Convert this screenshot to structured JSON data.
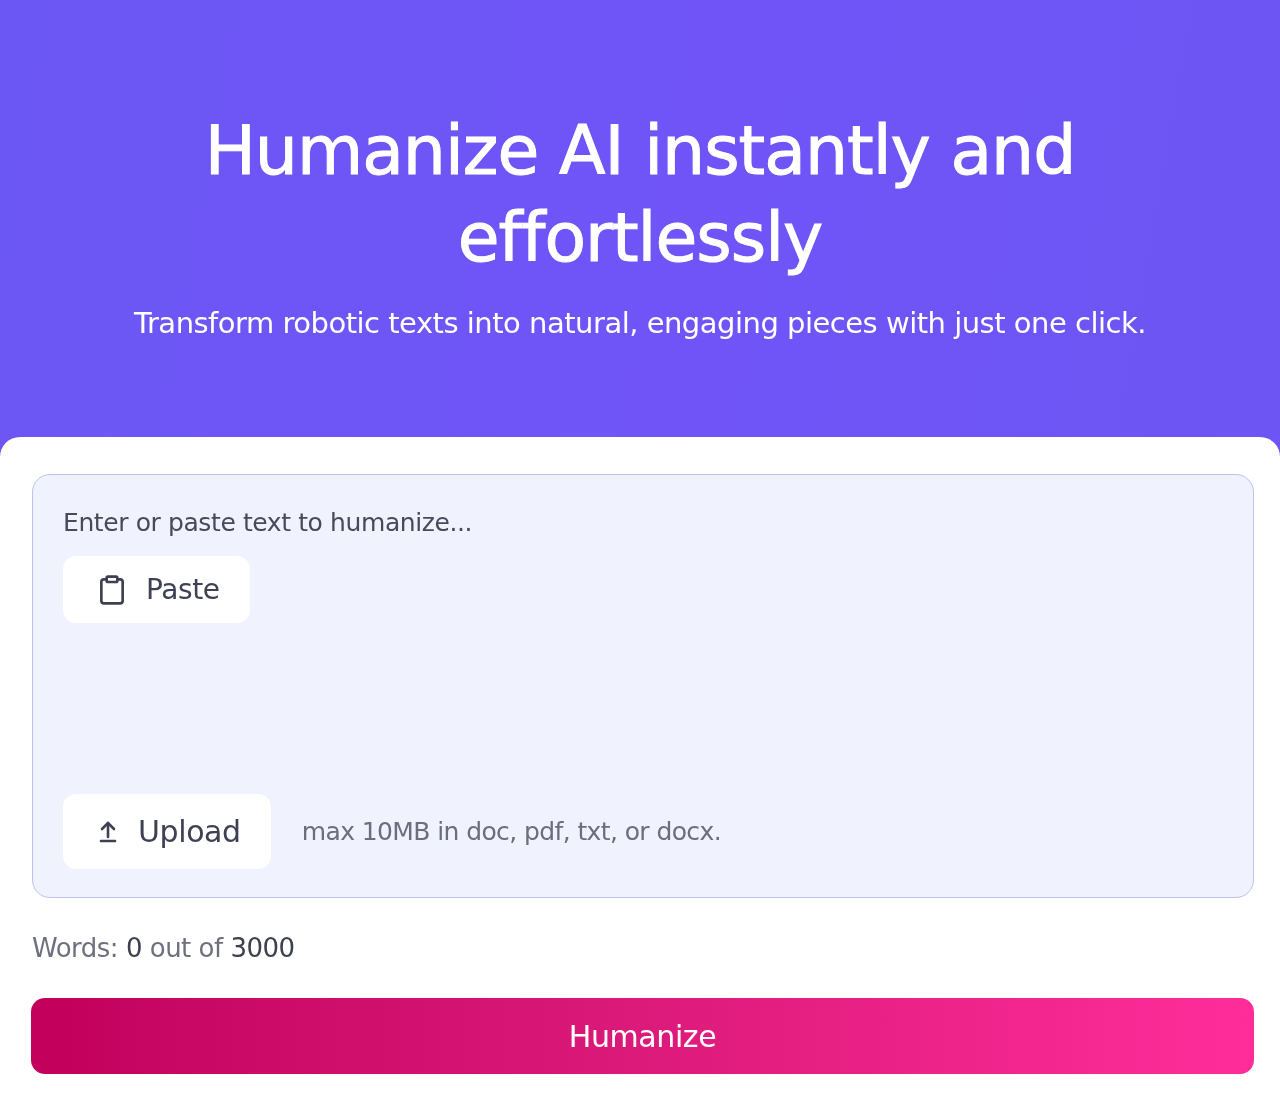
{
  "hero": {
    "title": "Humanize AI instantly and effortlessly",
    "subtitle": "Transform robotic texts into natural, engaging pieces with just one click."
  },
  "editor": {
    "placeholder": "Enter or paste text to humanize...",
    "paste_button": "Paste",
    "upload_button": "Upload",
    "upload_hint": "max 10MB in doc, pdf, txt, or docx."
  },
  "word_counter": "Words: **0** out of **3000**",
  "submit_button": "Humanize"
}
